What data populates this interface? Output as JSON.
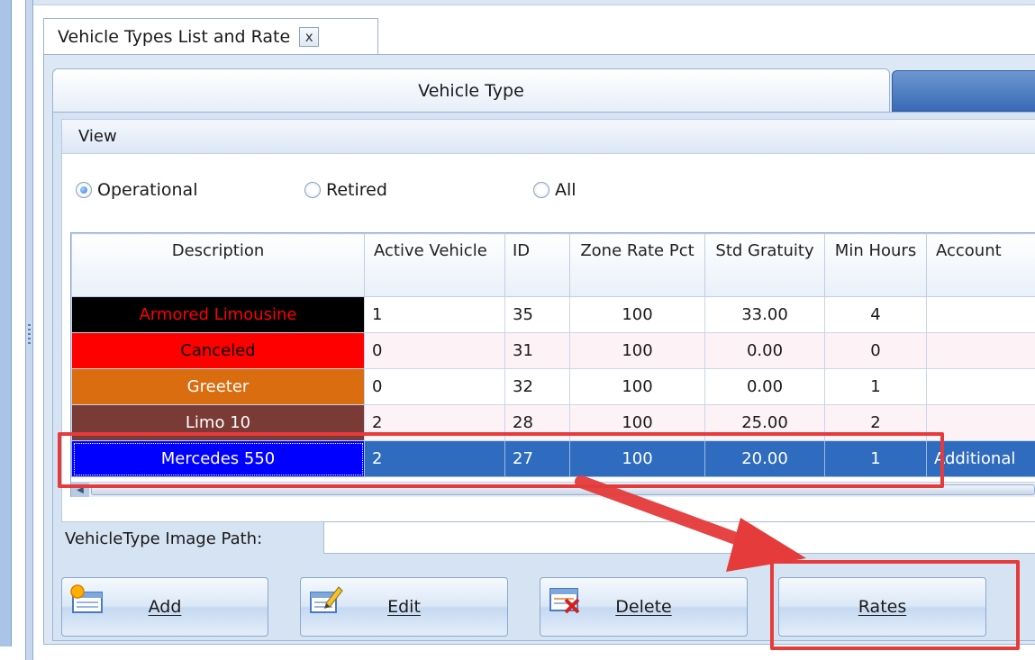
{
  "window": {
    "tab_title": "Vehicle Types List and Rate",
    "close_glyph": "x"
  },
  "tabs": {
    "active": "Vehicle Type"
  },
  "view": {
    "header": "View",
    "options": [
      "Operational",
      "Retired",
      "All"
    ],
    "selected": "Operational"
  },
  "grid": {
    "columns": [
      "Description",
      "Active Vehicle",
      "ID",
      "Zone Rate Pct",
      "Std Gratuity",
      "Min Hours",
      "Account"
    ],
    "rows": [
      {
        "description": "Armored Limousine",
        "active_vehicle": "1",
        "id": "35",
        "zone_rate_pct": "100",
        "std_gratuity": "33.00",
        "min_hours": "4",
        "account": "",
        "bg": "#000000",
        "fg": "#ff0000"
      },
      {
        "description": "Canceled",
        "active_vehicle": "0",
        "id": "31",
        "zone_rate_pct": "100",
        "std_gratuity": "0.00",
        "min_hours": "0",
        "account": "",
        "bg": "#ff0000",
        "fg": "#000000"
      },
      {
        "description": "Greeter",
        "active_vehicle": "0",
        "id": "32",
        "zone_rate_pct": "100",
        "std_gratuity": "0.00",
        "min_hours": "1",
        "account": "",
        "bg": "#d96d10",
        "fg": "#ffffff"
      },
      {
        "description": "Limo 10",
        "active_vehicle": "2",
        "id": "28",
        "zone_rate_pct": "100",
        "std_gratuity": "25.00",
        "min_hours": "2",
        "account": "",
        "bg": "#7a3a36",
        "fg": "#ffffff"
      },
      {
        "description": "Mercedes 550",
        "active_vehicle": "2",
        "id": "27",
        "zone_rate_pct": "100",
        "std_gratuity": "20.00",
        "min_hours": "1",
        "account": "Additional",
        "bg": "#0000ff",
        "fg": "#ffffff",
        "selected": true
      }
    ]
  },
  "image_path": {
    "label": "VehicleType Image Path:",
    "value": ""
  },
  "buttons": {
    "add": "Add",
    "edit": "Edit",
    "delete": "Delete",
    "rates": "Rates"
  },
  "colors": {
    "highlight": "#e53b3b",
    "selection": "#2f6cc0"
  }
}
